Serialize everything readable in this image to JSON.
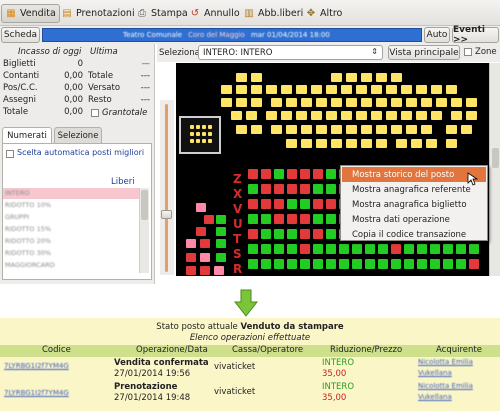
{
  "toolbar": {
    "items": [
      {
        "label": "Vendita",
        "icon": "ticket-icon",
        "active": true
      },
      {
        "label": "Prenotazioni",
        "icon": "calendar-icon",
        "active": false
      },
      {
        "label": "Stampa",
        "icon": "printer-icon",
        "active": false
      },
      {
        "label": "Annullo",
        "icon": "cancel-icon",
        "active": false
      },
      {
        "label": "Abb.liberi",
        "icon": "subscription-icon",
        "active": false
      },
      {
        "label": "Altro",
        "icon": "tools-icon",
        "active": false
      }
    ]
  },
  "event_bar": {
    "scheda_label": "Scheda",
    "event_parts": [
      "Teatro Comunale",
      "Coro del Maggio",
      "mar 01/04/2014 18:00"
    ],
    "auto_label": "Auto",
    "eventi_label": "Eventi >>"
  },
  "cash": {
    "header_left": "Incasso di oggi",
    "header_right": "Ultima",
    "rows_left": [
      {
        "label": "Biglietti",
        "value": "0"
      },
      {
        "label": "Contanti",
        "value": "0,00"
      },
      {
        "label": "Pos/C.C.",
        "value": "0,00"
      },
      {
        "label": "Assegni",
        "value": "0,00"
      },
      {
        "label": "Totale",
        "value": "0,00"
      }
    ],
    "rows_right": [
      {
        "label": "",
        "value": "—"
      },
      {
        "label": "Totale",
        "value": "---"
      },
      {
        "label": "Versato",
        "value": "---"
      },
      {
        "label": "Resto",
        "value": "---"
      }
    ],
    "grantotale_label": "Grantotale"
  },
  "tabs": {
    "numerati": "Numerati",
    "selezione": "Selezione"
  },
  "numerati": {
    "auto_select_label": "Scelta automatica posti migliori",
    "liberi_header": "Liberi",
    "rows": [
      "INTERO",
      "RIDOTTO 10%",
      "GRUPPI",
      "RIDOTTO 15%",
      "RIDOTTO 20%",
      "RIDOTTO 30%",
      "MAGGIORCARD"
    ]
  },
  "center": {
    "seleziona_label": "Seleziona",
    "combo_value": "INTERO: INTERO",
    "vista_label": "Vista principale",
    "zone_label": "Zone"
  },
  "map": {
    "row_letters": [
      "Z",
      "X",
      "V",
      "U",
      "T",
      "S",
      "R"
    ]
  },
  "context_menu": {
    "items": [
      "Mostra storico del posto",
      "Mostra anagrafica referente",
      "Mostra anagrafica biglietto",
      "Mostra dati operazione",
      "Copia il codice transazione"
    ],
    "highlighted_index": 0
  },
  "status": {
    "line1_prefix": "Stato posto attuale ",
    "line1_value": "Venduto da stampare",
    "line2": "Elenco operazioni effettuate"
  },
  "operations": {
    "columns": [
      "Codice",
      "Operazione/Data",
      "Cassa/Operatore",
      "Riduzione/Prezzo",
      "Acquirente"
    ],
    "rows": [
      {
        "codice": "7LYRBG1I2f7YM4G",
        "operazione": "Vendita confermata",
        "data": "27/01/2014 19:56",
        "cassa": "vivaticket",
        "riduzione": "INTERO",
        "prezzo": "35,00",
        "acquirente1": "Nicolotta Emilia",
        "acquirente2": "Vukellana"
      },
      {
        "codice": "7LYRBG1I2f7YM4G",
        "operazione": "Prenotazione",
        "data": "27/01/2014 19:48",
        "cassa": "vivaticket",
        "riduzione": "INTERO",
        "prezzo": "35,00",
        "acquirente1": "Nicolotta Emilia",
        "acquirente2": "Vukellana"
      }
    ]
  },
  "colors": {
    "seat_yellow": "#ffe466",
    "seat_green": "#22cc22",
    "seat_red": "#e23a3a",
    "seat_pink": "#ff8aa8",
    "highlight": "#e2753d",
    "header_green": "#cfe08d",
    "bottom_bg": "#fbf6c8"
  }
}
